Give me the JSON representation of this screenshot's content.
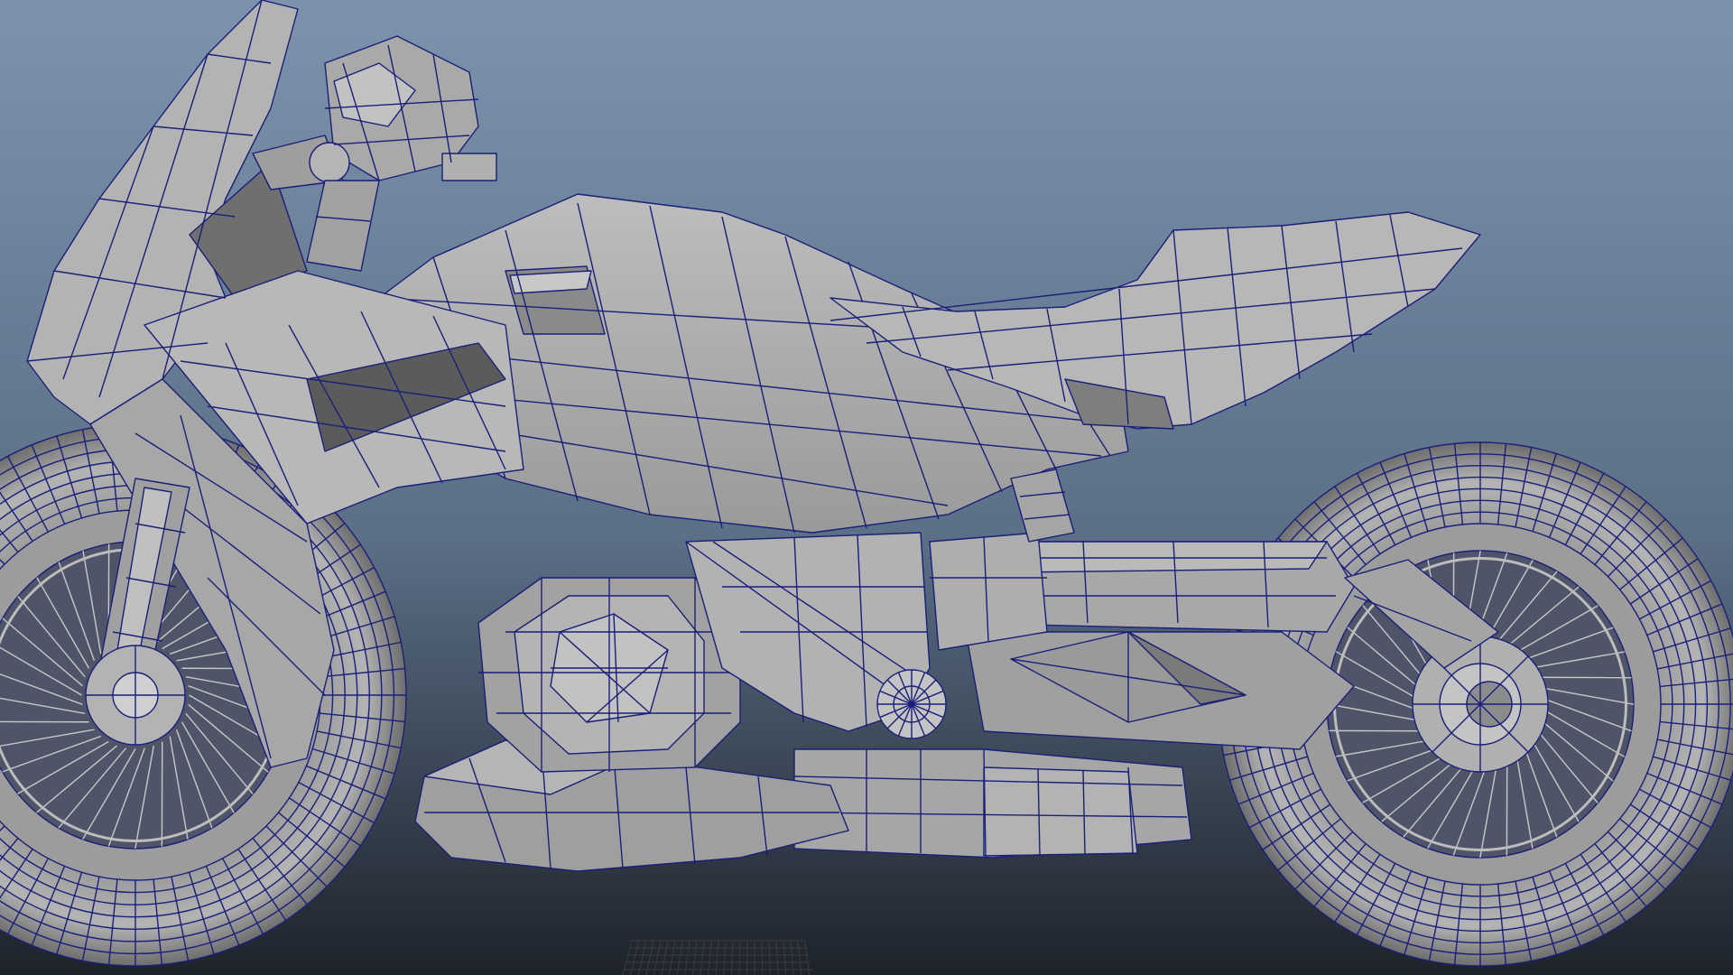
{
  "viewport": {
    "background_top": "#7d93ad",
    "background_bottom": "#1e232b",
    "mesh_fill": "#a9a9a9",
    "mesh_fill_light": "#b9b9b9",
    "mesh_fill_dark": "#6f6f6f",
    "mesh_shadow": "#3a3a3a",
    "wire_color": "#1a1f78",
    "grid_color": "#3b3b3b"
  },
  "model": {
    "name_icon": "motorcycle-wireframe-model",
    "display_mode": "wireframe-on-shaded"
  }
}
